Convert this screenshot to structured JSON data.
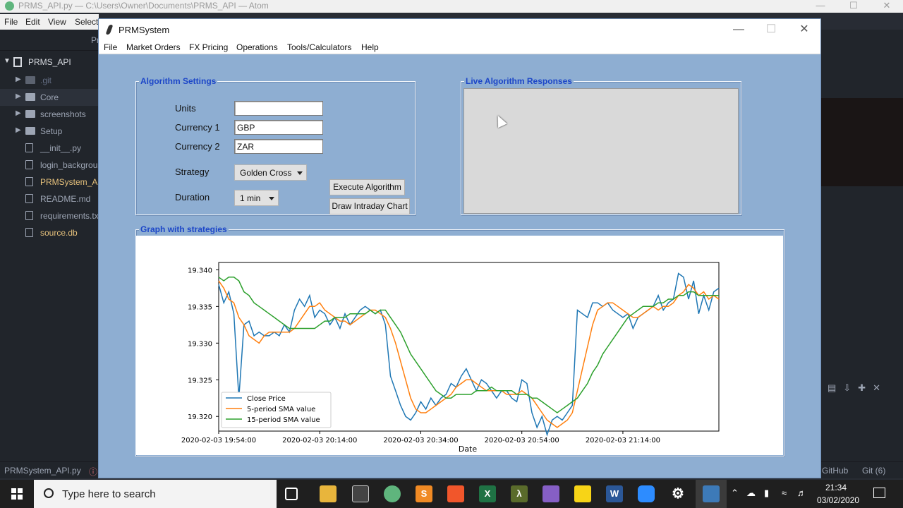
{
  "atom": {
    "title": "PRMS_API.py — C:\\Users\\Owner\\Documents\\PRMS_API — Atom",
    "menu": [
      "File",
      "Edit",
      "View",
      "Select"
    ],
    "tab_partial": "Pr",
    "project": "PRMS_API",
    "tree": [
      {
        "label": ".git",
        "type": "folder"
      },
      {
        "label": "Core",
        "type": "folder"
      },
      {
        "label": "screenshots",
        "type": "folder"
      },
      {
        "label": "Setup",
        "type": "folder"
      },
      {
        "label": "__init__.py",
        "type": "file"
      },
      {
        "label": "login_backgrou",
        "type": "file"
      },
      {
        "label": "PRMSystem_AP",
        "type": "file"
      },
      {
        "label": "README.md",
        "type": "file"
      },
      {
        "label": "requirements.tx",
        "type": "file"
      },
      {
        "label": "source.db",
        "type": "file"
      }
    ],
    "status": {
      "file": "PRMSystem_API.py",
      "error_icon": "ⓘ",
      "github": "GitHub",
      "git": "Git (6)"
    }
  },
  "prm": {
    "title": "PRMSystem",
    "menu": [
      "File",
      "Market Orders",
      "FX Pricing",
      "Operations",
      "Tools/Calculators",
      "Help"
    ],
    "settings": {
      "title": "Algorithm Settings",
      "units_label": "Units",
      "units_value": "",
      "currency1_label": "Currency 1",
      "currency1_value": "GBP",
      "currency2_label": "Currency 2",
      "currency2_value": "ZAR",
      "strategy_label": "Strategy",
      "strategy_value": "Golden Cross",
      "duration_label": "Duration",
      "duration_value": "1 min",
      "execute_label": "Execute Algorithm",
      "draw_label": "Draw Intraday Chart"
    },
    "responses": {
      "title": "Live Algorithm Responses"
    },
    "graph": {
      "title": "Graph with strategies"
    }
  },
  "chart_data": {
    "type": "line",
    "xlabel": "Date",
    "ylabel": "",
    "x_ticks": [
      "2020-02-03 19:54:00",
      "2020-02-03 20:14:00",
      "2020-02-03 20:34:00",
      "2020-02-03 20:54:00",
      "2020-02-03 21:14:00"
    ],
    "y_ticks": [
      "19.320",
      "19.325",
      "19.330",
      "19.335",
      "19.340"
    ],
    "xlim": [
      0,
      99
    ],
    "ylim": [
      19.318,
      19.341
    ],
    "legend": "lower-left",
    "grid": false,
    "series": [
      {
        "name": "Close Price",
        "color": "#1f77b4",
        "values": [
          19.338,
          19.3355,
          19.337,
          19.334,
          19.3225,
          19.3325,
          19.333,
          19.331,
          19.3315,
          19.331,
          19.331,
          19.3315,
          19.331,
          19.3325,
          19.3315,
          19.3345,
          19.336,
          19.335,
          19.3365,
          19.3335,
          19.3345,
          19.334,
          19.3325,
          19.3335,
          19.332,
          19.334,
          19.3325,
          19.3335,
          19.3345,
          19.335,
          19.3345,
          19.334,
          19.3345,
          19.3325,
          19.3255,
          19.3235,
          19.3215,
          19.32,
          19.3195,
          19.3205,
          19.322,
          19.321,
          19.3225,
          19.3215,
          19.3225,
          19.323,
          19.3245,
          19.324,
          19.3255,
          19.3265,
          19.325,
          19.3235,
          19.325,
          19.3245,
          19.3235,
          19.3225,
          19.3235,
          19.3235,
          19.3225,
          19.322,
          19.325,
          19.3245,
          19.3205,
          19.3185,
          19.32,
          19.3175,
          19.3195,
          19.32,
          19.3195,
          19.3205,
          19.3215,
          19.3345,
          19.334,
          19.3335,
          19.3355,
          19.3355,
          19.335,
          19.3355,
          19.3345,
          19.334,
          19.3335,
          19.334,
          19.332,
          19.3335,
          19.334,
          19.3345,
          19.335,
          19.3365,
          19.3345,
          19.3355,
          19.336,
          19.3395,
          19.339,
          19.336,
          19.3385,
          19.334,
          19.3365,
          19.3345,
          19.337,
          19.3375
        ]
      },
      {
        "name": "5-period SMA value",
        "color": "#ff7f0e",
        "values": [
          19.3385,
          19.3375,
          19.336,
          19.3355,
          19.3335,
          19.3325,
          19.331,
          19.3305,
          19.33,
          19.331,
          19.3315,
          19.3315,
          19.3315,
          19.3315,
          19.3315,
          19.332,
          19.333,
          19.334,
          19.335,
          19.335,
          19.3355,
          19.3345,
          19.334,
          19.3335,
          19.333,
          19.333,
          19.3325,
          19.333,
          19.3335,
          19.334,
          19.3345,
          19.3345,
          19.334,
          19.3335,
          19.332,
          19.33,
          19.3275,
          19.325,
          19.3225,
          19.321,
          19.3205,
          19.3205,
          19.321,
          19.3215,
          19.322,
          19.3225,
          19.323,
          19.324,
          19.3245,
          19.325,
          19.325,
          19.3245,
          19.324,
          19.3235,
          19.3235,
          19.3235,
          19.3235,
          19.323,
          19.323,
          19.323,
          19.3235,
          19.323,
          19.3225,
          19.3215,
          19.3205,
          19.3195,
          19.319,
          19.3185,
          19.319,
          19.3195,
          19.3205,
          19.3235,
          19.3265,
          19.3295,
          19.3325,
          19.3345,
          19.335,
          19.3355,
          19.3355,
          19.335,
          19.3345,
          19.334,
          19.3335,
          19.3335,
          19.334,
          19.3345,
          19.335,
          19.3345,
          19.335,
          19.335,
          19.3355,
          19.3365,
          19.337,
          19.338,
          19.3375,
          19.3365,
          19.337,
          19.336,
          19.3365,
          19.336
        ]
      },
      {
        "name": "15-period SMA value",
        "color": "#2ca02c",
        "values": [
          19.339,
          19.3385,
          19.339,
          19.339,
          19.3385,
          19.337,
          19.3365,
          19.3355,
          19.335,
          19.3345,
          19.334,
          19.3335,
          19.333,
          19.3325,
          19.332,
          19.332,
          19.332,
          19.332,
          19.332,
          19.332,
          19.3325,
          19.333,
          19.333,
          19.3335,
          19.3335,
          19.3335,
          19.334,
          19.334,
          19.334,
          19.334,
          19.3345,
          19.334,
          19.3345,
          19.3345,
          19.3335,
          19.3325,
          19.3315,
          19.33,
          19.3285,
          19.3275,
          19.3265,
          19.3255,
          19.3245,
          19.3235,
          19.323,
          19.3225,
          19.3225,
          19.323,
          19.323,
          19.323,
          19.323,
          19.3235,
          19.3235,
          19.3235,
          19.324,
          19.3235,
          19.3235,
          19.3235,
          19.3235,
          19.323,
          19.323,
          19.323,
          19.3225,
          19.3225,
          19.322,
          19.3215,
          19.321,
          19.3205,
          19.321,
          19.3215,
          19.322,
          19.3225,
          19.3235,
          19.3245,
          19.326,
          19.327,
          19.3285,
          19.3295,
          19.3305,
          19.3315,
          19.3325,
          19.3335,
          19.334,
          19.3345,
          19.335,
          19.335,
          19.335,
          19.3355,
          19.3355,
          19.336,
          19.336,
          19.3365,
          19.3365,
          19.337,
          19.337,
          19.3365,
          19.3365,
          19.3365,
          19.3365,
          19.3365
        ]
      }
    ]
  },
  "taskbar": {
    "search_placeholder": "Type here to search",
    "time": "21:34",
    "date": "03/02/2020",
    "icons": [
      "task-view-icon",
      "file-explorer-icon",
      "calculator-icon",
      "atom-app-icon",
      "sublime-text-icon",
      "brave-browser-icon",
      "excel-icon",
      "lambda-app-icon",
      "visual-studio-icon",
      "sticky-notes-icon",
      "word-icon",
      "zoom-icon",
      "settings-icon",
      "python-icon"
    ]
  }
}
